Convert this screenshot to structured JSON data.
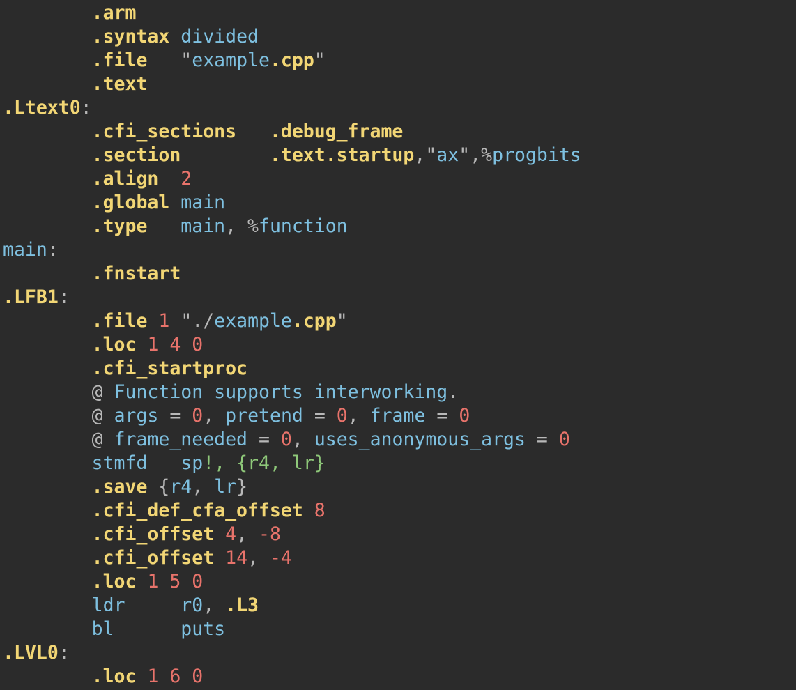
{
  "editor": {
    "language": "ARM assembly",
    "colors": {
      "background": "#2b2b2b",
      "directive": "#f2d675",
      "identifier": "#7ec0e0",
      "number": "#e8736b",
      "punctuation": "#b8b8b8",
      "register_list": "#8fc97a"
    },
    "lines": [
      [
        {
          "t": "        ",
          "c": "plain"
        },
        {
          "t": ".arm",
          "c": "directive"
        }
      ],
      [
        {
          "t": "        ",
          "c": "plain"
        },
        {
          "t": ".syntax",
          "c": "directive"
        },
        {
          "t": " ",
          "c": "plain"
        },
        {
          "t": "divided",
          "c": "ident"
        }
      ],
      [
        {
          "t": "        ",
          "c": "plain"
        },
        {
          "t": ".file",
          "c": "directive"
        },
        {
          "t": "   ",
          "c": "plain"
        },
        {
          "t": "\"",
          "c": "punct"
        },
        {
          "t": "example",
          "c": "string"
        },
        {
          "t": ".cpp",
          "c": "directive"
        },
        {
          "t": "\"",
          "c": "punct"
        }
      ],
      [
        {
          "t": "        ",
          "c": "plain"
        },
        {
          "t": ".text",
          "c": "directive"
        }
      ],
      [
        {
          "t": ".Ltext0",
          "c": "label"
        },
        {
          "t": ":",
          "c": "punct"
        }
      ],
      [
        {
          "t": "        ",
          "c": "plain"
        },
        {
          "t": ".cfi_sections",
          "c": "directive"
        },
        {
          "t": "   ",
          "c": "plain"
        },
        {
          "t": ".debug_frame",
          "c": "directive"
        }
      ],
      [
        {
          "t": "        ",
          "c": "plain"
        },
        {
          "t": ".section",
          "c": "directive"
        },
        {
          "t": "        ",
          "c": "plain"
        },
        {
          "t": ".text.startup",
          "c": "directive"
        },
        {
          "t": ",",
          "c": "punct"
        },
        {
          "t": "\"",
          "c": "punct"
        },
        {
          "t": "ax",
          "c": "string"
        },
        {
          "t": "\"",
          "c": "punct"
        },
        {
          "t": ",",
          "c": "punct"
        },
        {
          "t": "%",
          "c": "punct"
        },
        {
          "t": "progbits",
          "c": "ident"
        }
      ],
      [
        {
          "t": "        ",
          "c": "plain"
        },
        {
          "t": ".align",
          "c": "directive"
        },
        {
          "t": "  ",
          "c": "plain"
        },
        {
          "t": "2",
          "c": "number"
        }
      ],
      [
        {
          "t": "        ",
          "c": "plain"
        },
        {
          "t": ".global",
          "c": "directive"
        },
        {
          "t": " ",
          "c": "plain"
        },
        {
          "t": "main",
          "c": "ident"
        }
      ],
      [
        {
          "t": "        ",
          "c": "plain"
        },
        {
          "t": ".type",
          "c": "directive"
        },
        {
          "t": "   ",
          "c": "plain"
        },
        {
          "t": "main",
          "c": "ident"
        },
        {
          "t": ", ",
          "c": "punct"
        },
        {
          "t": "%",
          "c": "punct"
        },
        {
          "t": "function",
          "c": "ident"
        }
      ],
      [
        {
          "t": "main",
          "c": "ident"
        },
        {
          "t": ":",
          "c": "punct"
        }
      ],
      [
        {
          "t": "        ",
          "c": "plain"
        },
        {
          "t": ".fnstart",
          "c": "directive"
        }
      ],
      [
        {
          "t": ".LFB1",
          "c": "label"
        },
        {
          "t": ":",
          "c": "punct"
        }
      ],
      [
        {
          "t": "        ",
          "c": "plain"
        },
        {
          "t": ".file",
          "c": "directive"
        },
        {
          "t": " ",
          "c": "plain"
        },
        {
          "t": "1",
          "c": "number"
        },
        {
          "t": " ",
          "c": "plain"
        },
        {
          "t": "\"./",
          "c": "punct"
        },
        {
          "t": "example",
          "c": "string"
        },
        {
          "t": ".cpp",
          "c": "directive"
        },
        {
          "t": "\"",
          "c": "punct"
        }
      ],
      [
        {
          "t": "        ",
          "c": "plain"
        },
        {
          "t": ".loc",
          "c": "directive"
        },
        {
          "t": " ",
          "c": "plain"
        },
        {
          "t": "1 4 0",
          "c": "number"
        }
      ],
      [
        {
          "t": "        ",
          "c": "plain"
        },
        {
          "t": ".cfi_startproc",
          "c": "directive"
        }
      ],
      [
        {
          "t": "        ",
          "c": "plain"
        },
        {
          "t": "@",
          "c": "punct"
        },
        {
          "t": " Function supports interworking",
          "c": "ident"
        },
        {
          "t": ".",
          "c": "punct"
        }
      ],
      [
        {
          "t": "        ",
          "c": "plain"
        },
        {
          "t": "@",
          "c": "punct"
        },
        {
          "t": " args ",
          "c": "ident"
        },
        {
          "t": "=",
          "c": "punct"
        },
        {
          "t": " ",
          "c": "plain"
        },
        {
          "t": "0",
          "c": "number"
        },
        {
          "t": ", ",
          "c": "punct"
        },
        {
          "t": "pretend ",
          "c": "ident"
        },
        {
          "t": "=",
          "c": "punct"
        },
        {
          "t": " ",
          "c": "plain"
        },
        {
          "t": "0",
          "c": "number"
        },
        {
          "t": ", ",
          "c": "punct"
        },
        {
          "t": "frame ",
          "c": "ident"
        },
        {
          "t": "=",
          "c": "punct"
        },
        {
          "t": " ",
          "c": "plain"
        },
        {
          "t": "0",
          "c": "number"
        }
      ],
      [
        {
          "t": "        ",
          "c": "plain"
        },
        {
          "t": "@",
          "c": "punct"
        },
        {
          "t": " frame_needed ",
          "c": "ident"
        },
        {
          "t": "=",
          "c": "punct"
        },
        {
          "t": " ",
          "c": "plain"
        },
        {
          "t": "0",
          "c": "number"
        },
        {
          "t": ", ",
          "c": "punct"
        },
        {
          "t": "uses_anonymous_args ",
          "c": "ident"
        },
        {
          "t": "=",
          "c": "punct"
        },
        {
          "t": " ",
          "c": "plain"
        },
        {
          "t": "0",
          "c": "number"
        }
      ],
      [
        {
          "t": "        ",
          "c": "plain"
        },
        {
          "t": "stmfd",
          "c": "ident"
        },
        {
          "t": "   ",
          "c": "plain"
        },
        {
          "t": "sp",
          "c": "ident"
        },
        {
          "t": "!, ",
          "c": "green"
        },
        {
          "t": "{r4, lr}",
          "c": "green"
        }
      ],
      [
        {
          "t": "        ",
          "c": "plain"
        },
        {
          "t": ".save",
          "c": "directive"
        },
        {
          "t": " ",
          "c": "plain"
        },
        {
          "t": "{",
          "c": "punct"
        },
        {
          "t": "r4",
          "c": "ident"
        },
        {
          "t": ", ",
          "c": "punct"
        },
        {
          "t": "lr",
          "c": "ident"
        },
        {
          "t": "}",
          "c": "punct"
        }
      ],
      [
        {
          "t": "        ",
          "c": "plain"
        },
        {
          "t": ".cfi_def_cfa_offset",
          "c": "directive"
        },
        {
          "t": " ",
          "c": "plain"
        },
        {
          "t": "8",
          "c": "number"
        }
      ],
      [
        {
          "t": "        ",
          "c": "plain"
        },
        {
          "t": ".cfi_offset",
          "c": "directive"
        },
        {
          "t": " ",
          "c": "plain"
        },
        {
          "t": "4",
          "c": "number"
        },
        {
          "t": ", ",
          "c": "punct"
        },
        {
          "t": "-8",
          "c": "number"
        }
      ],
      [
        {
          "t": "        ",
          "c": "plain"
        },
        {
          "t": ".cfi_offset",
          "c": "directive"
        },
        {
          "t": " ",
          "c": "plain"
        },
        {
          "t": "14",
          "c": "number"
        },
        {
          "t": ", ",
          "c": "punct"
        },
        {
          "t": "-4",
          "c": "number"
        }
      ],
      [
        {
          "t": "        ",
          "c": "plain"
        },
        {
          "t": ".loc",
          "c": "directive"
        },
        {
          "t": " ",
          "c": "plain"
        },
        {
          "t": "1 5 0",
          "c": "number"
        }
      ],
      [
        {
          "t": "        ",
          "c": "plain"
        },
        {
          "t": "ldr",
          "c": "ident"
        },
        {
          "t": "     ",
          "c": "plain"
        },
        {
          "t": "r0",
          "c": "ident"
        },
        {
          "t": ", ",
          "c": "punct"
        },
        {
          "t": ".L3",
          "c": "directive"
        }
      ],
      [
        {
          "t": "        ",
          "c": "plain"
        },
        {
          "t": "bl",
          "c": "ident"
        },
        {
          "t": "      ",
          "c": "plain"
        },
        {
          "t": "puts",
          "c": "ident"
        }
      ],
      [
        {
          "t": ".LVL0",
          "c": "label"
        },
        {
          "t": ":",
          "c": "punct"
        }
      ],
      [
        {
          "t": "        ",
          "c": "plain"
        },
        {
          "t": ".loc",
          "c": "directive"
        },
        {
          "t": " ",
          "c": "plain"
        },
        {
          "t": "1 6 0",
          "c": "number"
        }
      ]
    ]
  }
}
